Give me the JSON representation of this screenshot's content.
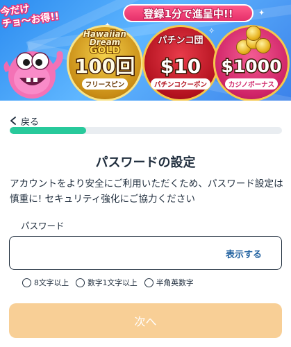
{
  "banner": {
    "tag_line1": "今だけ",
    "tag_line2": "チョ〜お得!!",
    "ribbon": "登録1分で進呈中!!",
    "medals": [
      {
        "top_line1": "Hawaiian",
        "top_line2": "Dream",
        "top_badge": "GOLD",
        "value": "100回",
        "label": "フリースピン"
      },
      {
        "top": "パチンコ団",
        "value": "$10",
        "label": "パチンコクーポン"
      },
      {
        "value": "$1000",
        "label": "カジノボーナス"
      }
    ]
  },
  "nav": {
    "back_label": "戻る"
  },
  "progress": {
    "value_percent": 28
  },
  "page": {
    "title": "パスワードの設定",
    "description": "アカウントをより安全にご利用いただくため、パスワード設定は慎重に! セキュリティ強化にご協力ください"
  },
  "password": {
    "label": "パスワード",
    "value": "",
    "placeholder": "",
    "show_label": "表示する"
  },
  "rules": [
    "8文字以上",
    "数字1文字以上",
    "半角英数字"
  ],
  "next_button": "次へ",
  "colors": {
    "progress": "#28c99b",
    "next_button": "#f8cf96",
    "show_link": "#1e5f9e",
    "banner_blue": "#3c8ff0"
  }
}
